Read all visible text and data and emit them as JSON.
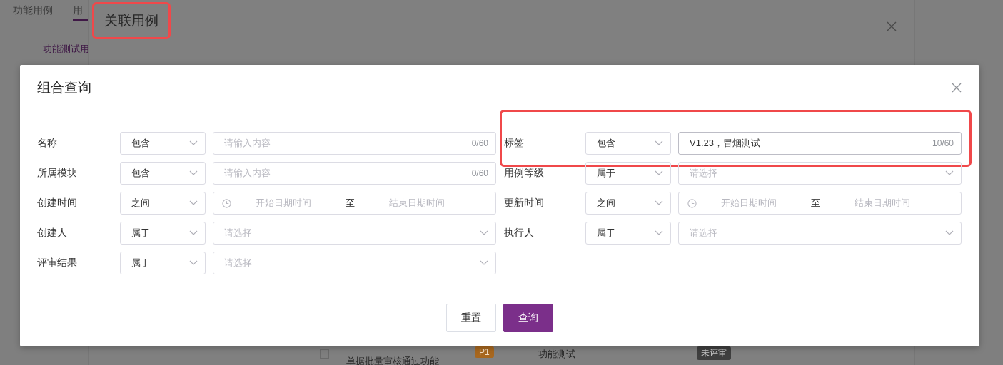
{
  "background": {
    "tabs": [
      {
        "label": "功能用例",
        "selected": false
      },
      {
        "label": "用",
        "selected": true
      }
    ],
    "sub_tabs": [
      {
        "label": "功能测试用",
        "selected": true
      }
    ],
    "row": {
      "checked": false,
      "title": "单据批量审核通过功能",
      "priority": "P1",
      "type": "功能测试",
      "review_status": "未评审"
    }
  },
  "dialog": {
    "title": "关联用例",
    "highlighted": true
  },
  "query_dialog": {
    "title": "组合查询",
    "fields": [
      {
        "label": "名称",
        "operator": "包含",
        "kind": "text",
        "placeholder": "请输入内容",
        "count": "0/60",
        "highlighted": false
      },
      {
        "label": "标签",
        "operator": "包含",
        "kind": "text",
        "value": "V1.23，冒烟测试",
        "count": "10/60",
        "highlighted": true
      },
      {
        "label": "所属模块",
        "operator": "包含",
        "kind": "text",
        "placeholder": "请输入内容",
        "count": "0/60",
        "highlighted": false
      },
      {
        "label": "用例等级",
        "operator": "属于",
        "kind": "select",
        "placeholder": "请选择",
        "highlighted": false
      },
      {
        "label": "创建时间",
        "operator": "之间",
        "kind": "daterange",
        "start_placeholder": "开始日期时间",
        "separator": "至",
        "end_placeholder": "结束日期时间",
        "highlighted": false
      },
      {
        "label": "更新时间",
        "operator": "之间",
        "kind": "daterange",
        "start_placeholder": "开始日期时间",
        "separator": "至",
        "end_placeholder": "结束日期时间",
        "highlighted": false
      },
      {
        "label": "创建人",
        "operator": "属于",
        "kind": "select",
        "placeholder": "请选择",
        "highlighted": false
      },
      {
        "label": "执行人",
        "operator": "属于",
        "kind": "select",
        "placeholder": "请选择",
        "highlighted": false
      },
      {
        "label": "评审结果",
        "operator": "属于",
        "kind": "select",
        "placeholder": "请选择",
        "highlighted": false
      }
    ],
    "buttons": [
      {
        "label": "重置",
        "kind": "secondary"
      },
      {
        "label": "查询",
        "kind": "primary"
      }
    ]
  }
}
